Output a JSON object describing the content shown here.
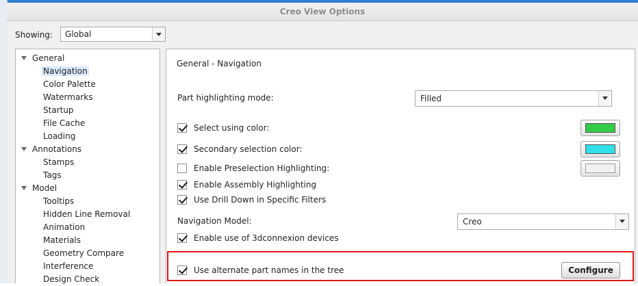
{
  "window": {
    "title": "Creo View Options"
  },
  "showing": {
    "label": "Showing:",
    "value": "Global"
  },
  "tree": {
    "groups": [
      {
        "label": "General",
        "items": [
          "Navigation",
          "Color Palette",
          "Watermarks",
          "Startup",
          "File Cache",
          "Loading"
        ],
        "selected": "Navigation"
      },
      {
        "label": "Annotations",
        "items": [
          "Stamps",
          "Tags"
        ]
      },
      {
        "label": "Model",
        "items": [
          "Tooltips",
          "Hidden Line Removal",
          "Animation",
          "Materials",
          "Geometry Compare",
          "Interference",
          "Design Check"
        ]
      }
    ]
  },
  "panel": {
    "title": "General - Navigation",
    "part_highlighting": {
      "label": "Part highlighting mode:",
      "value": "Filled"
    },
    "select_using_color": {
      "label": "Select using color:",
      "checked": true,
      "color": "#33cc4a"
    },
    "secondary_selection_color": {
      "label": "Secondary selection color:",
      "checked": true,
      "color": "#2fe0e8"
    },
    "enable_preselection": {
      "label": "Enable Preselection Highlighting:",
      "checked": false,
      "color": "#f2f2f2"
    },
    "enable_assembly": {
      "label": "Enable Assembly Highlighting",
      "checked": true
    },
    "drill_down": {
      "label": "Use Drill Down in Specific Filters",
      "checked": true
    },
    "navigation_model": {
      "label": "Navigation Model:",
      "value": "Creo"
    },
    "threedconnexion": {
      "label": "Enable use of 3dconnexion devices",
      "checked": true
    },
    "alternate_names": {
      "label": "Use alternate part names in the tree",
      "checked": true
    },
    "configure_label": "Configure"
  }
}
